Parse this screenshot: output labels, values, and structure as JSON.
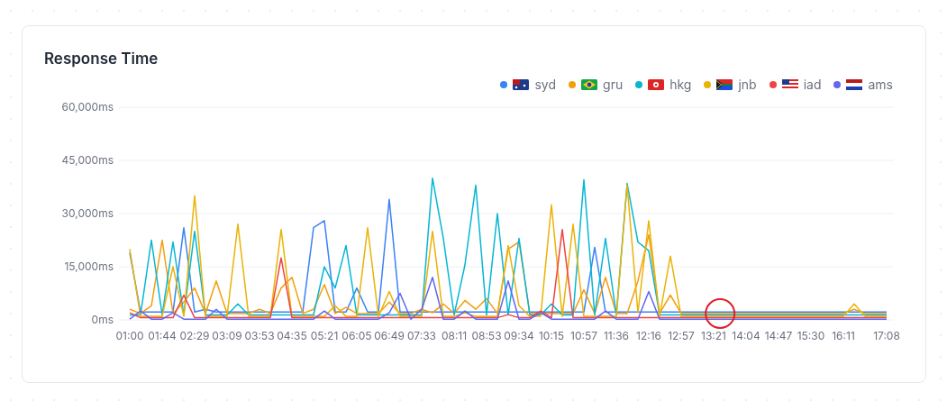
{
  "card": {
    "chart_data": {
      "type": "line",
      "title": "Response Time",
      "grid": true,
      "categories": [
        "01:00",
        null,
        null,
        "01:44",
        null,
        null,
        "02:29",
        null,
        null,
        "03:09",
        null,
        null,
        "03:53",
        null,
        null,
        "04:35",
        null,
        null,
        "05:21",
        null,
        null,
        "06:05",
        null,
        null,
        "06:49",
        null,
        null,
        "07:33",
        null,
        null,
        "08:11",
        null,
        null,
        "08:53",
        null,
        null,
        "09:34",
        null,
        null,
        "10:15",
        null,
        null,
        "10:57",
        null,
        null,
        "11:36",
        null,
        null,
        "12:16",
        null,
        null,
        "12:57",
        null,
        null,
        "13:21",
        null,
        null,
        "14:04",
        null,
        null,
        "14:47",
        null,
        null,
        "15:30",
        null,
        null,
        "16:11",
        null,
        null,
        null,
        "17:08"
      ],
      "ylim": [
        0,
        60000
      ],
      "yticks": [
        {
          "value": 0,
          "label": "0ms"
        },
        {
          "value": 15000,
          "label": "15,000ms"
        },
        {
          "value": 30000,
          "label": "30,000ms"
        },
        {
          "value": 45000,
          "label": "45,000ms"
        },
        {
          "value": 60000,
          "label": "60,000ms"
        }
      ],
      "series": [
        {
          "name": "syd",
          "color": "#3b82f6",
          "values": [
            19000,
            2200,
            2200,
            2200,
            2200,
            26000,
            2200,
            3000,
            2200,
            2200,
            2200,
            2200,
            2200,
            2200,
            2200,
            2200,
            2200,
            26000,
            28000,
            2200,
            2200,
            9000,
            2200,
            2200,
            34000,
            2200,
            2200,
            2200,
            2200,
            2200,
            2200,
            2200,
            2200,
            2200,
            2200,
            2200,
            2200,
            2200,
            2200,
            2200,
            2200,
            2200,
            2200,
            20500,
            2200,
            2200,
            2200,
            2200,
            2200,
            2200,
            2200,
            2200,
            2200,
            2200,
            2200,
            2200,
            2200,
            2200,
            2200,
            2200,
            2200,
            2200,
            2200,
            2200,
            2200,
            2200,
            2200,
            2200,
            2200,
            2200,
            2200
          ]
        },
        {
          "name": "gru",
          "color": "#f59e0b",
          "values": [
            3000,
            1800,
            4000,
            22500,
            1800,
            5000,
            9000,
            1800,
            11000,
            1800,
            1800,
            1800,
            3000,
            1800,
            9000,
            12000,
            1800,
            3000,
            10000,
            1800,
            3500,
            1800,
            1800,
            1800,
            5000,
            1800,
            1800,
            3000,
            2000,
            4500,
            1800,
            5500,
            3000,
            6000,
            1800,
            20000,
            22000,
            1800,
            1800,
            1800,
            1800,
            1800,
            8500,
            1800,
            12000,
            1800,
            1800,
            11000,
            24000,
            1800,
            7000,
            1800,
            1800,
            1800,
            1800,
            1800,
            1800,
            1800,
            1800,
            1800,
            1800,
            1800,
            1800,
            1800,
            1800,
            1800,
            1800,
            3000,
            1800,
            1800,
            1800
          ]
        },
        {
          "name": "hkg",
          "color": "#06b6d4",
          "values": [
            1400,
            1400,
            22500,
            1400,
            22000,
            1400,
            25000,
            1400,
            1400,
            1400,
            4500,
            1400,
            1400,
            1400,
            1400,
            1400,
            1400,
            1400,
            15000,
            9000,
            21000,
            1400,
            1400,
            1400,
            1400,
            1400,
            1400,
            1400,
            40000,
            23000,
            1400,
            15500,
            38000,
            1400,
            30000,
            1400,
            23000,
            1400,
            1400,
            4500,
            1400,
            1400,
            39500,
            1400,
            23000,
            1400,
            38500,
            22000,
            19500,
            1400,
            1400,
            1400,
            1400,
            1400,
            1400,
            1400,
            1400,
            1400,
            1400,
            1400,
            1400,
            1400,
            1400,
            1400,
            1400,
            1400,
            1400,
            1400,
            1400,
            1400,
            1400
          ]
        },
        {
          "name": "jnb",
          "color": "#eab308",
          "values": [
            20000,
            1000,
            1000,
            1000,
            15000,
            1000,
            35000,
            1000,
            1000,
            1000,
            27000,
            1000,
            1000,
            1000,
            25500,
            1000,
            1000,
            1000,
            1000,
            4000,
            1000,
            1000,
            26000,
            1000,
            8000,
            1000,
            1000,
            1000,
            25000,
            1000,
            1000,
            2000,
            1000,
            1000,
            1000,
            21000,
            4000,
            1000,
            1000,
            32500,
            1000,
            27000,
            1000,
            1000,
            1000,
            1000,
            38000,
            2000,
            28000,
            1000,
            18000,
            1000,
            1000,
            1000,
            1000,
            1000,
            1000,
            1000,
            1000,
            1000,
            1000,
            1000,
            1000,
            1000,
            1000,
            1000,
            1000,
            4500,
            1000,
            1000,
            1000
          ]
        },
        {
          "name": "iad",
          "color": "#ef4444",
          "values": [
            2000,
            600,
            600,
            600,
            600,
            7000,
            600,
            600,
            600,
            600,
            600,
            600,
            600,
            600,
            17500,
            600,
            600,
            600,
            600,
            600,
            600,
            600,
            600,
            600,
            600,
            600,
            600,
            600,
            600,
            600,
            600,
            600,
            600,
            600,
            600,
            1500,
            600,
            600,
            2500,
            600,
            25500,
            600,
            600,
            600,
            600,
            600,
            600,
            600,
            600,
            600,
            600,
            600,
            600,
            600,
            600,
            600,
            600,
            600,
            600,
            600,
            600,
            600,
            600,
            600,
            600,
            600,
            600,
            600,
            600,
            600,
            600
          ]
        },
        {
          "name": "ams",
          "color": "#6366f1",
          "values": [
            200,
            2500,
            200,
            200,
            2000,
            200,
            200,
            200,
            3000,
            200,
            200,
            200,
            200,
            200,
            200,
            200,
            200,
            200,
            2500,
            200,
            200,
            200,
            200,
            200,
            2000,
            7500,
            200,
            3000,
            12000,
            200,
            200,
            2500,
            200,
            200,
            200,
            11000,
            200,
            200,
            2000,
            200,
            200,
            200,
            200,
            200,
            2500,
            200,
            200,
            200,
            8000,
            200,
            200,
            200,
            200,
            200,
            200,
            200,
            200,
            200,
            200,
            200,
            200,
            200,
            200,
            200,
            200,
            200,
            200,
            200,
            200,
            200,
            200
          ]
        }
      ]
    }
  }
}
